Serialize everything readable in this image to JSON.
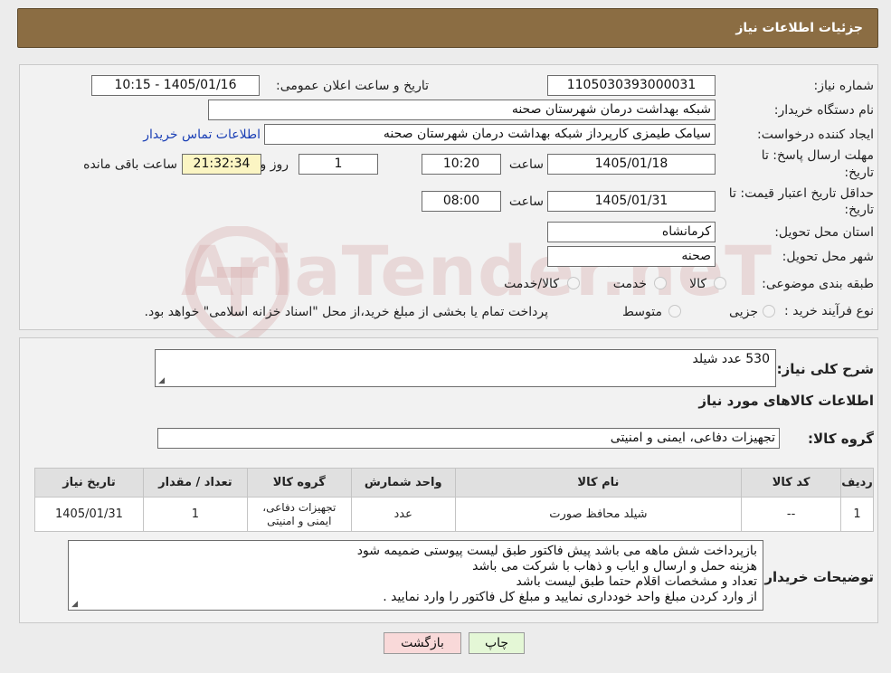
{
  "header": {
    "title": "جزئیات اطلاعات نیاز"
  },
  "form": {
    "need_number_label": "شماره نیاز:",
    "need_number": "1105030393000031",
    "announce_label": "تاریخ و ساعت اعلان عمومی:",
    "announce_value": "1405/01/16 - 10:15",
    "buyer_org_label": "نام دستگاه خریدار:",
    "buyer_org": "شبکه بهداشت درمان شهرستان صحنه",
    "creator_label": "ایجاد کننده درخواست:",
    "creator": "سیامک طیمزی کارپرداز شبکه بهداشت درمان شهرستان صحنه",
    "contact_link": "اطلاعات تماس خریدار",
    "deadline_label_1": "مهلت ارسال پاسخ: تا",
    "deadline_label_2": "تاریخ:",
    "deadline_date": "1405/01/18",
    "time_label": "ساعت",
    "deadline_time": "10:20",
    "days_value": "1",
    "days_label": "روز و",
    "remaining_value": "21:32:34",
    "remaining_label": "ساعت باقی مانده",
    "validity_label_1": "حداقل تاریخ اعتبار قیمت: تا",
    "validity_label_2": "تاریخ:",
    "validity_date": "1405/01/31",
    "validity_time": "08:00",
    "province_label": "استان محل تحویل:",
    "province": "کرمانشاه",
    "city_label": "شهر محل تحویل:",
    "city": "صحنه",
    "category_label": "طبقه بندی موضوعی:",
    "category_options": [
      "کالا",
      "خدمت",
      "کالا/خدمت"
    ],
    "process_label": "نوع فرآیند خرید :",
    "process_options": [
      "جزیی",
      "متوسط"
    ],
    "process_note": "پرداخت تمام یا بخشی از مبلغ خرید،از محل \"اسناد خزانه اسلامی\" خواهد بود."
  },
  "details": {
    "summary_label": "شرح کلی نیاز:",
    "summary": "530 عدد شیلد",
    "goods_info_title": "اطلاعات کالاهای مورد نیاز",
    "goods_group_label": "گروه کالا:",
    "goods_group": "تجهیزات دفاعی، ایمنی و امنیتی",
    "table": {
      "headers": [
        "ردیف",
        "کد کالا",
        "نام کالا",
        "واحد شمارش",
        "گروه کالا",
        "تعداد / مقدار",
        "تاریخ نیاز"
      ],
      "rows": [
        [
          "1",
          "--",
          "شیلد محافظ صورت",
          "عدد",
          "تجهیزات دفاعی، ایمنی و امنیتی",
          "1",
          "1405/01/31"
        ]
      ]
    },
    "buyer_notes_label": "توضیحات خریدار:",
    "buyer_notes": [
      "بازپرداخت شش ماهه می باشد پیش فاکتور طبق لیست پیوستی ضمیمه شود",
      "هزینه حمل و ارسال و ایاب و ذهاب با شرکت می باشد",
      "تعداد و مشخصات اقلام حتما طبق لیست باشد",
      "از وارد کردن مبلغ واحد خودداری نمایید و مبلغ کل فاکتور را وارد نمایید ."
    ]
  },
  "buttons": {
    "print": "چاپ",
    "back": "بازگشت"
  },
  "watermark": "AriaTender.neT",
  "colors": {
    "header": "#8b6d43",
    "remaining_bg": "#fbf5c3",
    "link": "#1a3fb5",
    "print_btn": "#e4f7d6",
    "back_btn": "#f9d9d9"
  }
}
